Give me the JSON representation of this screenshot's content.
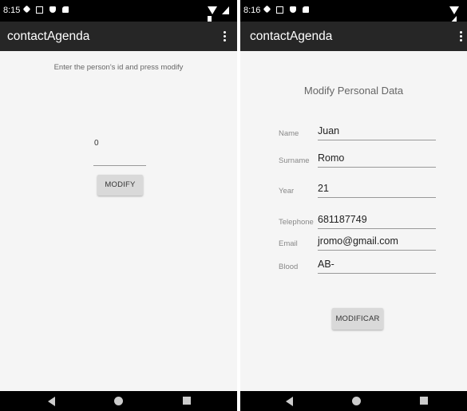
{
  "left_screen": {
    "status": {
      "time": "8:15",
      "icons": [
        "gear-icon",
        "square-icon",
        "shield-icon",
        "sd-card-icon"
      ],
      "system_icons": [
        "wifi-icon",
        "signal-icon",
        "battery-icon"
      ]
    },
    "app_bar": {
      "title": "contactAgenda",
      "menu_icon": "kebab-menu-icon"
    },
    "hint": "Enter the person's id and press modify",
    "id_input": {
      "value": "0"
    },
    "modify_button": "MODIFY",
    "nav": [
      "back-icon",
      "home-icon",
      "recents-icon"
    ]
  },
  "right_screen": {
    "status": {
      "time": "8:16",
      "icons": [
        "gear-icon",
        "square-icon",
        "shield-icon",
        "sd-card-icon"
      ],
      "system_icons": [
        "wifi-icon",
        "signal-icon"
      ]
    },
    "app_bar": {
      "title": "contactAgenda",
      "menu_icon": "kebab-menu-icon"
    },
    "form_title": "Modify Personal Data",
    "fields": {
      "name": {
        "label": "Name",
        "value": "Juan"
      },
      "surname": {
        "label": "Surname",
        "value": "Romo"
      },
      "year": {
        "label": "Year",
        "value": "21"
      },
      "telephone": {
        "label": "Telephone",
        "value": "681187749"
      },
      "email": {
        "label": "Email",
        "value": "jromo@gmail.com"
      },
      "blood": {
        "label": "Blood",
        "value": "AB-"
      }
    },
    "modificar_button": "MODIFICAR",
    "nav": [
      "back-icon",
      "home-icon",
      "recents-icon"
    ]
  },
  "colors": {
    "status_bar": "#000000",
    "app_bar": "#262626",
    "content_background": "#f5f5f5",
    "button": "#d9d9d9",
    "nav_bar": "#000000"
  }
}
